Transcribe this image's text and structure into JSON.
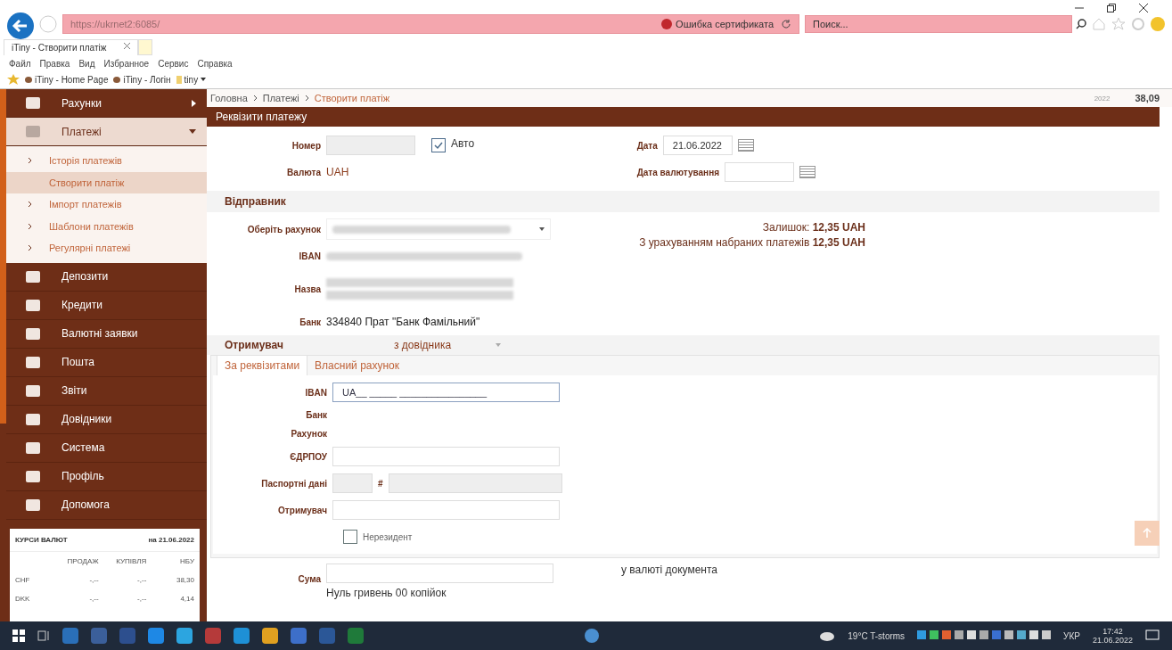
{
  "browser": {
    "address": "https://ukrnet2:6085/",
    "cert_error": "Ошибка сертификата",
    "search_placeholder": "Поиск...",
    "tab_title": "iTiny - Створити платіж",
    "menu": [
      "Файл",
      "Правка",
      "Вид",
      "Избранное",
      "Сервис",
      "Справка"
    ],
    "favorites": [
      "iTiny - Home Page",
      "iTiny - Логін",
      "tiny"
    ]
  },
  "header": {
    "year": "2022",
    "amount": "38,09"
  },
  "breadcrumb": [
    {
      "label": "Головна",
      "current": false
    },
    {
      "label": "Платежі",
      "current": false
    },
    {
      "label": "Створити платіж",
      "current": true
    }
  ],
  "sidebar": {
    "items": [
      {
        "label": "Рахунки",
        "expanded": false,
        "has_arrow": true
      },
      {
        "label": "Платежі",
        "expanded": true,
        "has_arrow": true,
        "children": [
          {
            "label": "Історія платежів",
            "selected": false
          },
          {
            "label": "Створити платіж",
            "selected": true
          },
          {
            "label": "Імпорт платежів",
            "selected": false
          },
          {
            "label": "Шаблони платежів",
            "selected": false
          },
          {
            "label": "Регулярні платежі",
            "selected": false
          }
        ]
      },
      {
        "label": "Депозити",
        "expanded": false,
        "has_arrow": false
      },
      {
        "label": "Кредити",
        "expanded": false,
        "has_arrow": false
      },
      {
        "label": "Валютні заявки",
        "expanded": false,
        "has_arrow": false
      },
      {
        "label": "Пошта",
        "expanded": false,
        "has_arrow": false
      },
      {
        "label": "Звіти",
        "expanded": false,
        "has_arrow": false
      },
      {
        "label": "Довідники",
        "expanded": false,
        "has_arrow": false
      },
      {
        "label": "Система",
        "expanded": false,
        "has_arrow": false
      },
      {
        "label": "Профіль",
        "expanded": false,
        "has_arrow": false
      },
      {
        "label": "Допомога",
        "expanded": false,
        "has_arrow": false
      }
    ],
    "rates": {
      "title": "КУРСИ ВАЛЮТ",
      "date": "на 21.06.2022",
      "columns": [
        "ПРОДАЖ",
        "КУПІВЛЯ",
        "НБУ"
      ],
      "rows": [
        {
          "currency": "CHF",
          "values": [
            "-,--",
            "-,--",
            "38,30"
          ]
        },
        {
          "currency": "DKK",
          "values": [
            "-,--",
            "-,--",
            "4,14"
          ]
        }
      ]
    }
  },
  "form": {
    "title": "Реквізити платежу",
    "number_label": "Номер",
    "auto": {
      "label": "Авто",
      "checked": true
    },
    "date_label": "Дата",
    "date_value": "21.06.2022",
    "currency_label": "Валюта",
    "currency_value": "UAH",
    "value_date_label": "Дата валютування",
    "sender": {
      "title": "Відправник",
      "account_label": "Оберіть рахунок",
      "iban_label": "IBAN",
      "name_label": "Назва",
      "bank_label": "Банк",
      "bank_value": "334840 Прат \"Банк Фамільний\"",
      "balance": "Залишок: **12,35 UAH**",
      "balance_with_pending": "З урахуванням набраних платежів **12,35 UAH**"
    },
    "recipient": {
      "title": "Отримувач",
      "source": "з довідника",
      "tabs": [
        {
          "label": "За реквізитами",
          "selected": true
        },
        {
          "label": "Власний рахунок",
          "selected": false
        }
      ],
      "iban_label": "IBAN",
      "iban_value": "UA__ _____ ________________",
      "bank_label": "Банк",
      "account_label": "Рахунок",
      "edrpou_label": "ЄДРПОУ",
      "passport_label": "Паспортні дані",
      "passport_hash": "#",
      "name_label": "Отримувач",
      "nonresident": {
        "label": "Нерезидент",
        "checked": false
      }
    },
    "sum_label": "Сума",
    "sum_currency_note": "у валюті документа",
    "sum_words": "Нуль гривень 00 копійок"
  },
  "taskbar": {
    "weather": "19°C T-storms",
    "language": "УКР",
    "time": "17:42",
    "date": "21.06.2022"
  }
}
